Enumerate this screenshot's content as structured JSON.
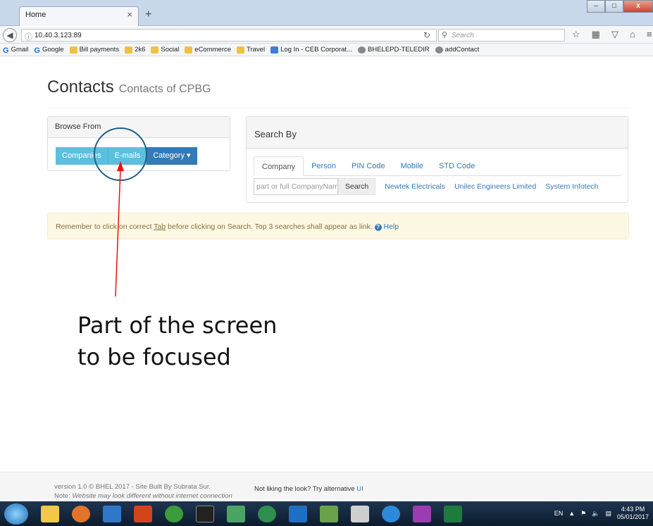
{
  "browser": {
    "tab_title": "Home",
    "tab_close": "×",
    "new_tab": "+",
    "url": "10.40.3.123:89",
    "search_placeholder": "Search",
    "window_buttons": [
      "–",
      "□",
      "x"
    ]
  },
  "bookmarks": [
    {
      "label": "Gmail",
      "icon": "google-icon"
    },
    {
      "label": "Google",
      "icon": "google-icon"
    },
    {
      "label": "Bill payments",
      "icon": "folder-icon"
    },
    {
      "label": "2k6",
      "icon": "folder-icon"
    },
    {
      "label": "Social",
      "icon": "folder-icon"
    },
    {
      "label": "eCommerce",
      "icon": "folder-icon"
    },
    {
      "label": "Travel",
      "icon": "folder-icon"
    },
    {
      "label": "Log In - CEB Corporat...",
      "icon": "page-icon"
    },
    {
      "label": "BHELEPD-TELEDIR",
      "icon": "globe-icon"
    },
    {
      "label": "addContact",
      "icon": "globe-icon"
    }
  ],
  "header": {
    "title": "Contacts",
    "subtitle": "Contacts of CPBG"
  },
  "browse": {
    "heading": "Browse From",
    "companies": "Companies",
    "emails": "E-mails",
    "category": "Category"
  },
  "search": {
    "heading": "Search By",
    "tabs": [
      "Company",
      "Person",
      "PIN Code",
      "Mobile",
      "STD Code"
    ],
    "placeholder": "part or full CompanyName",
    "button": "Search",
    "recent": [
      "Newtek Electricals",
      "Unilec Engineers Limited",
      "System Infotech"
    ]
  },
  "alert": {
    "before": "Remember to click on correct ",
    "tab_word": "Tab",
    "after": " before clicking on Search. Top 3 searches shall appear as link.",
    "help": "Help"
  },
  "footer": {
    "version": "version 1.0 © BHEL 2017 - Site Built By Subrata Sur.",
    "note_label": "Note:",
    "note": "Website may look different without internet connection",
    "alt_text": "Not liking the look? Try alternative",
    "alt_link": "UI"
  },
  "annotation": {
    "line1": "Part of the screen",
    "line2": "to be focused"
  },
  "taskbar": {
    "lang": "EN",
    "time": "4:43 PM",
    "date": "05/01/2017"
  },
  "colors": {
    "primary": "#337ab7",
    "info": "#5bc0de",
    "warning_bg": "#fcf8e3",
    "arrow": "#e8130c",
    "circle": "#1f5f8b"
  }
}
